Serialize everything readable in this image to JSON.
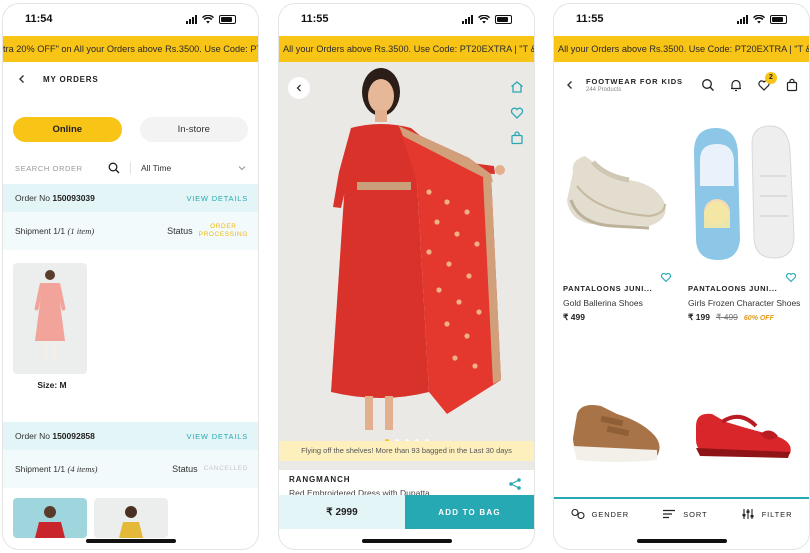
{
  "status_times": [
    "11:54",
    "11:55",
    "11:55"
  ],
  "promo": {
    "s1": "tra 20% OFF\" on All your Orders above Rs.3500. Use Code: PT20",
    "s2": "All your Orders above Rs.3500. Use Code: PT20EXTRA | \"T & C",
    "s3": "All your Orders above Rs.3500. Use Code: PT20EXTRA | \"T & C A"
  },
  "orders": {
    "title": "MY ORDERS",
    "tabs": [
      "Online",
      "In-store"
    ],
    "search_placeholder": "SEARCH ORDER",
    "time_filter": "All Time",
    "list": [
      {
        "order_label": "Order No",
        "order_no": "150093039",
        "view_details": "VIEW DETAILS",
        "shipment_label": "Shipment",
        "shipment_count": "1/1",
        "items": "(1 item)",
        "status_label": "Status",
        "status_value_1": "ORDER",
        "status_value_2": "PROCESSING",
        "size": "Size: M"
      },
      {
        "order_label": "Order No",
        "order_no": "150092858",
        "view_details": "VIEW DETAILS",
        "shipment_label": "Shipment",
        "shipment_count": "1/1",
        "items": "(4 items)",
        "status_label": "Status",
        "status_value_1": "CANCELLED"
      }
    ]
  },
  "product": {
    "bagged_banner": "Flying off the shelves! More than 93 bagged in the Last 30 days",
    "brand": "RANGMANCH",
    "name": "Red Embroidered Dress with Dupatta",
    "price": "₹ 2999",
    "add_to_bag": "ADD TO BAG"
  },
  "listing": {
    "title": "FOOTWEAR FOR KIDS",
    "count": "244 Products",
    "bag_badge": "2",
    "products": [
      {
        "brand": "PANTALOONS JUNI...",
        "name": "Gold Ballerina Shoes",
        "price": "₹ 499",
        "mrp": "",
        "off": ""
      },
      {
        "brand": "PANTALOONS JUNI...",
        "name": "Girls Frozen Character Shoes",
        "price": "₹ 199",
        "mrp": "₹ 499",
        "off": "60% OFF"
      }
    ],
    "bottom": [
      "GENDER",
      "SORT",
      "FILTER"
    ]
  },
  "colors": {
    "accent_yellow": "#f8c416",
    "teal": "#27a9b4",
    "light_teal": "#e4f5f7"
  }
}
